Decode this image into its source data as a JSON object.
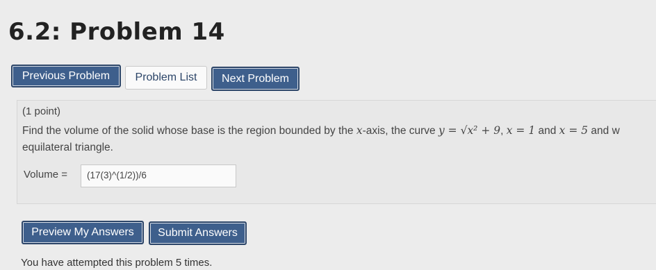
{
  "page": {
    "title": "6.2: Problem 14"
  },
  "nav": {
    "previous": "Previous Problem",
    "list": "Problem List",
    "next": "Next Problem"
  },
  "problem": {
    "points": "(1 point)",
    "text_before": "Find the volume of the solid whose base is the region bounded by the ",
    "x_var": "x",
    "text_axis": "-axis, the curve ",
    "curve": "y = √x² + 9",
    "text_sep1": ", ",
    "bound1": "x = 1",
    "text_and": " and ",
    "bound2": "x = 5",
    "text_after": " and w",
    "text_line2": "equilateral triangle.",
    "answer_label": "Volume =",
    "answer_value": "(17(3)^(1/2))/6"
  },
  "actions": {
    "preview": "Preview My Answers",
    "submit": "Submit Answers"
  },
  "status": {
    "attempts": "You have attempted this problem 5 times."
  },
  "colors": {
    "primary_button": "#3e5f8c",
    "background": "#ececec"
  }
}
